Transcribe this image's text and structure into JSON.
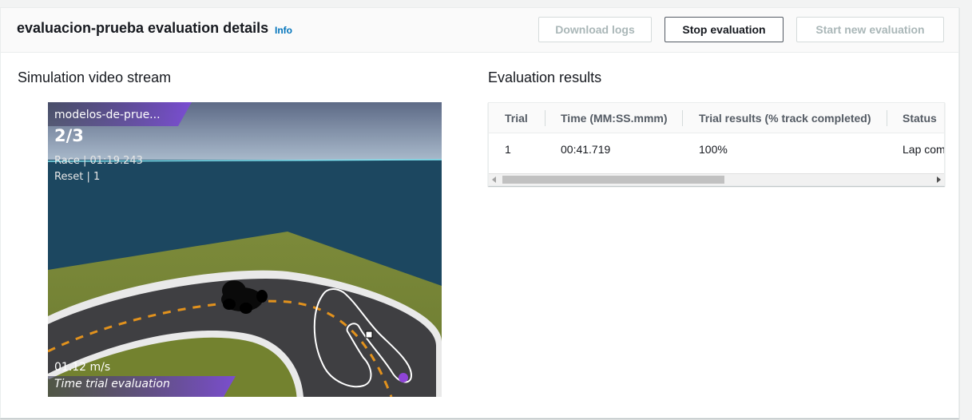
{
  "header": {
    "title": "evaluacion-prueba evaluation details",
    "info_link": "Info",
    "buttons": {
      "download_logs": "Download logs",
      "stop_evaluation": "Stop evaluation",
      "start_new_evaluation": "Start new evaluation"
    }
  },
  "video": {
    "section_title": "Simulation video stream",
    "overlay": {
      "model_name": "modelos-de-prue...",
      "lap": "2/3",
      "race_time": "Race | 01:19.243",
      "reset": "Reset | 1",
      "speed": "01.12 m/s",
      "mode": "Time trial evaluation"
    }
  },
  "results": {
    "section_title": "Evaluation results",
    "columns": [
      "Trial",
      "Time (MM:SS.mmm)",
      "Trial results (% track completed)",
      "Status"
    ],
    "rows": [
      {
        "trial": "1",
        "time": "00:41.719",
        "completed": "100%",
        "status": "Lap com"
      }
    ]
  },
  "colors": {
    "link": "#0073bb",
    "disabled_text": "#aab7b8",
    "overlay_accent": "#7b4bd6"
  }
}
